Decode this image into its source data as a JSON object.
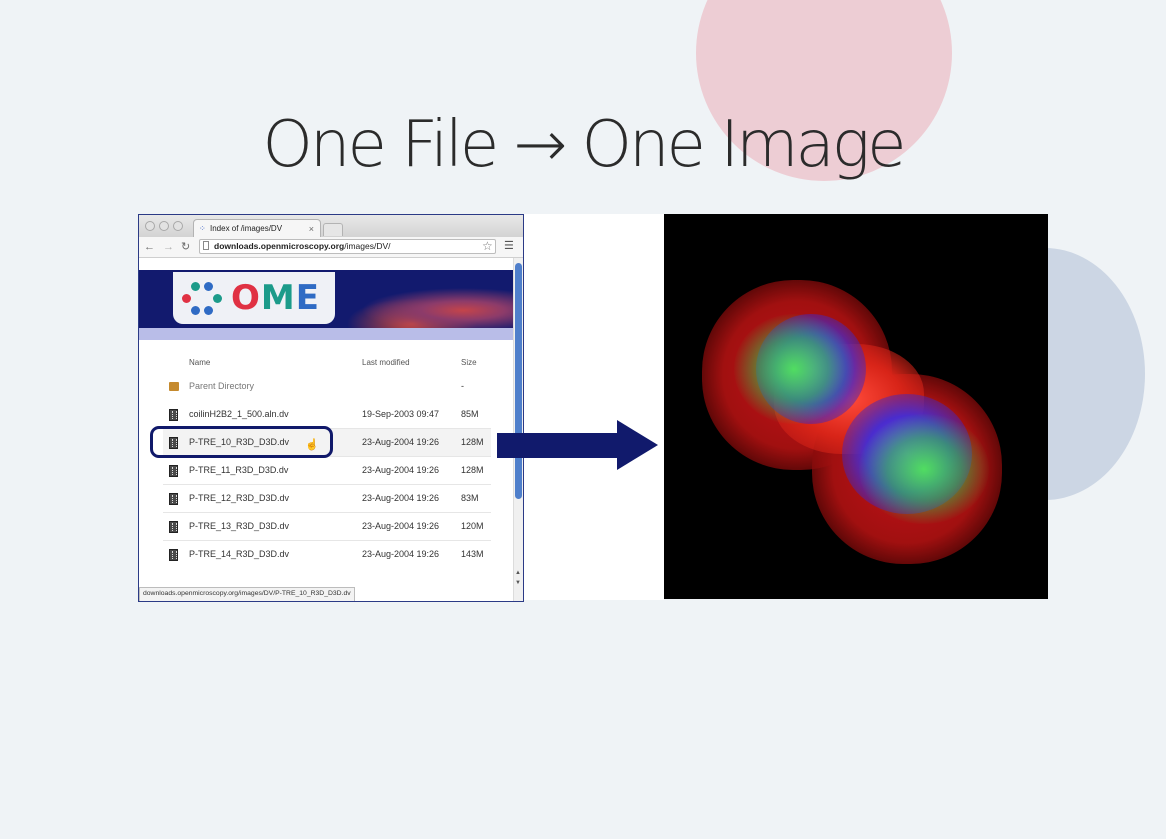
{
  "slide": {
    "title": "One File → One Image"
  },
  "browser": {
    "tab_title": "Index of /images/DV",
    "tab_close": "×",
    "url_host": "downloads.openmicroscopy.org",
    "url_path": "/images/DV/",
    "logo_text_o": "O",
    "logo_text_m": "M",
    "logo_text_e": "E",
    "columns": {
      "name": "Name",
      "modified": "Last modified",
      "size": "Size"
    },
    "parent": {
      "name": "Parent Directory",
      "size": "-"
    },
    "files": [
      {
        "name": "coilinH2B2_1_500.aln.dv",
        "modified": "19-Sep-2003 09:47",
        "size": "85M"
      },
      {
        "name": "P-TRE_10_R3D_D3D.dv",
        "modified": "23-Aug-2004 19:26",
        "size": "128M"
      },
      {
        "name": "P-TRE_11_R3D_D3D.dv",
        "modified": "23-Aug-2004 19:26",
        "size": "128M"
      },
      {
        "name": "P-TRE_12_R3D_D3D.dv",
        "modified": "23-Aug-2004 19:26",
        "size": "83M"
      },
      {
        "name": "P-TRE_13_R3D_D3D.dv",
        "modified": "23-Aug-2004 19:26",
        "size": "120M"
      },
      {
        "name": "P-TRE_14_R3D_D3D.dv",
        "modified": "23-Aug-2004 19:26",
        "size": "143M"
      }
    ],
    "selected_file": "P-TRE_10_R3D_D3D.dv",
    "status_url": "downloads.openmicroscopy.org/images/DV/P-TRE_10_R3D_D3D.dv"
  },
  "icons": {
    "back": "back-arrow-icon",
    "forward": "forward-arrow-icon",
    "reload": "reload-icon",
    "bookmark": "star-icon",
    "menu": "hamburger-menu-icon",
    "file": "film-file-icon",
    "folder": "folder-icon",
    "cursor": "hand-cursor-icon",
    "arrow": "right-arrow-icon"
  },
  "colors": {
    "background": "#eff3f6",
    "deco_pink": "#edcdd4",
    "deco_blue": "#ccd6e4",
    "ome_navy": "#121a6e",
    "highlight": "#10196a",
    "arrow": "#111a6c"
  },
  "micrograph": {
    "channels": [
      "red",
      "green",
      "blue"
    ]
  }
}
